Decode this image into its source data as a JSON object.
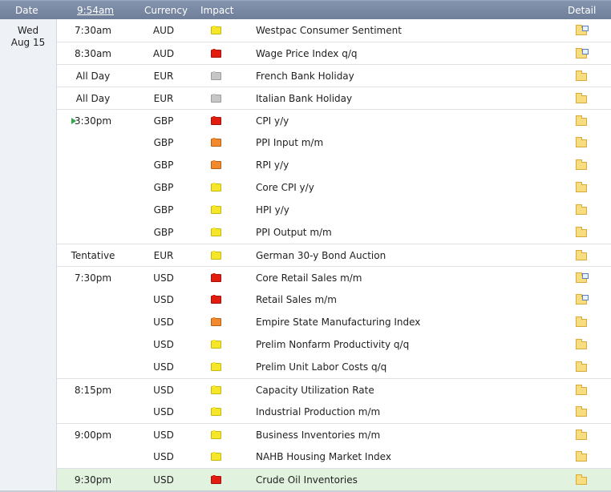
{
  "header": {
    "date": "Date",
    "time": "9:54am",
    "currency": "Currency",
    "impact": "Impact",
    "detail": "Detail"
  },
  "date": {
    "day": "Wed",
    "date": "Aug 15"
  },
  "impact_colors": {
    "high": "#e21c0e",
    "medium": "#f08a2c",
    "low": "#f5e62a",
    "holiday": "#c6c6c6"
  },
  "rows": [
    {
      "time": "7:30am",
      "currency": "AUD",
      "impact": "low",
      "event": "Westpac Consumer Sentiment",
      "detail_icon": "folder-doc-icon"
    },
    {
      "time": "8:30am",
      "currency": "AUD",
      "impact": "high",
      "event": "Wage Price Index q/q",
      "detail_icon": "folder-doc-icon"
    },
    {
      "time": "All Day",
      "currency": "EUR",
      "impact": "holiday",
      "event": "French Bank Holiday",
      "detail_icon": "folder-icon"
    },
    {
      "time": "All Day",
      "currency": "EUR",
      "impact": "holiday",
      "event": "Italian Bank Holiday",
      "detail_icon": "folder-icon"
    },
    {
      "time": "3:30pm",
      "currency": "GBP",
      "impact": "high",
      "event": "CPI y/y",
      "detail_icon": "folder-icon",
      "next": true
    },
    {
      "time": "",
      "currency": "GBP",
      "impact": "medium",
      "event": "PPI Input m/m",
      "detail_icon": "folder-icon"
    },
    {
      "time": "",
      "currency": "GBP",
      "impact": "medium",
      "event": "RPI y/y",
      "detail_icon": "folder-icon"
    },
    {
      "time": "",
      "currency": "GBP",
      "impact": "low",
      "event": "Core CPI y/y",
      "detail_icon": "folder-icon"
    },
    {
      "time": "",
      "currency": "GBP",
      "impact": "low",
      "event": "HPI y/y",
      "detail_icon": "folder-icon"
    },
    {
      "time": "",
      "currency": "GBP",
      "impact": "low",
      "event": "PPI Output m/m",
      "detail_icon": "folder-icon"
    },
    {
      "time": "Tentative",
      "currency": "EUR",
      "impact": "low",
      "event": "German 30-y Bond Auction",
      "detail_icon": "folder-icon"
    },
    {
      "time": "7:30pm",
      "currency": "USD",
      "impact": "high",
      "event": "Core Retail Sales m/m",
      "detail_icon": "folder-doc-icon"
    },
    {
      "time": "",
      "currency": "USD",
      "impact": "high",
      "event": "Retail Sales m/m",
      "detail_icon": "folder-doc-icon"
    },
    {
      "time": "",
      "currency": "USD",
      "impact": "medium",
      "event": "Empire State Manufacturing Index",
      "detail_icon": "folder-icon"
    },
    {
      "time": "",
      "currency": "USD",
      "impact": "low",
      "event": "Prelim Nonfarm Productivity q/q",
      "detail_icon": "folder-icon"
    },
    {
      "time": "",
      "currency": "USD",
      "impact": "low",
      "event": "Prelim Unit Labor Costs q/q",
      "detail_icon": "folder-icon"
    },
    {
      "time": "8:15pm",
      "currency": "USD",
      "impact": "low",
      "event": "Capacity Utilization Rate",
      "detail_icon": "folder-icon"
    },
    {
      "time": "",
      "currency": "USD",
      "impact": "low",
      "event": "Industrial Production m/m",
      "detail_icon": "folder-icon"
    },
    {
      "time": "9:00pm",
      "currency": "USD",
      "impact": "low",
      "event": "Business Inventories m/m",
      "detail_icon": "folder-icon"
    },
    {
      "time": "",
      "currency": "USD",
      "impact": "low",
      "event": "NAHB Housing Market Index",
      "detail_icon": "folder-icon"
    },
    {
      "time": "9:30pm",
      "currency": "USD",
      "impact": "high",
      "event": "Crude Oil Inventories",
      "detail_icon": "folder-icon",
      "highlight": true
    }
  ]
}
